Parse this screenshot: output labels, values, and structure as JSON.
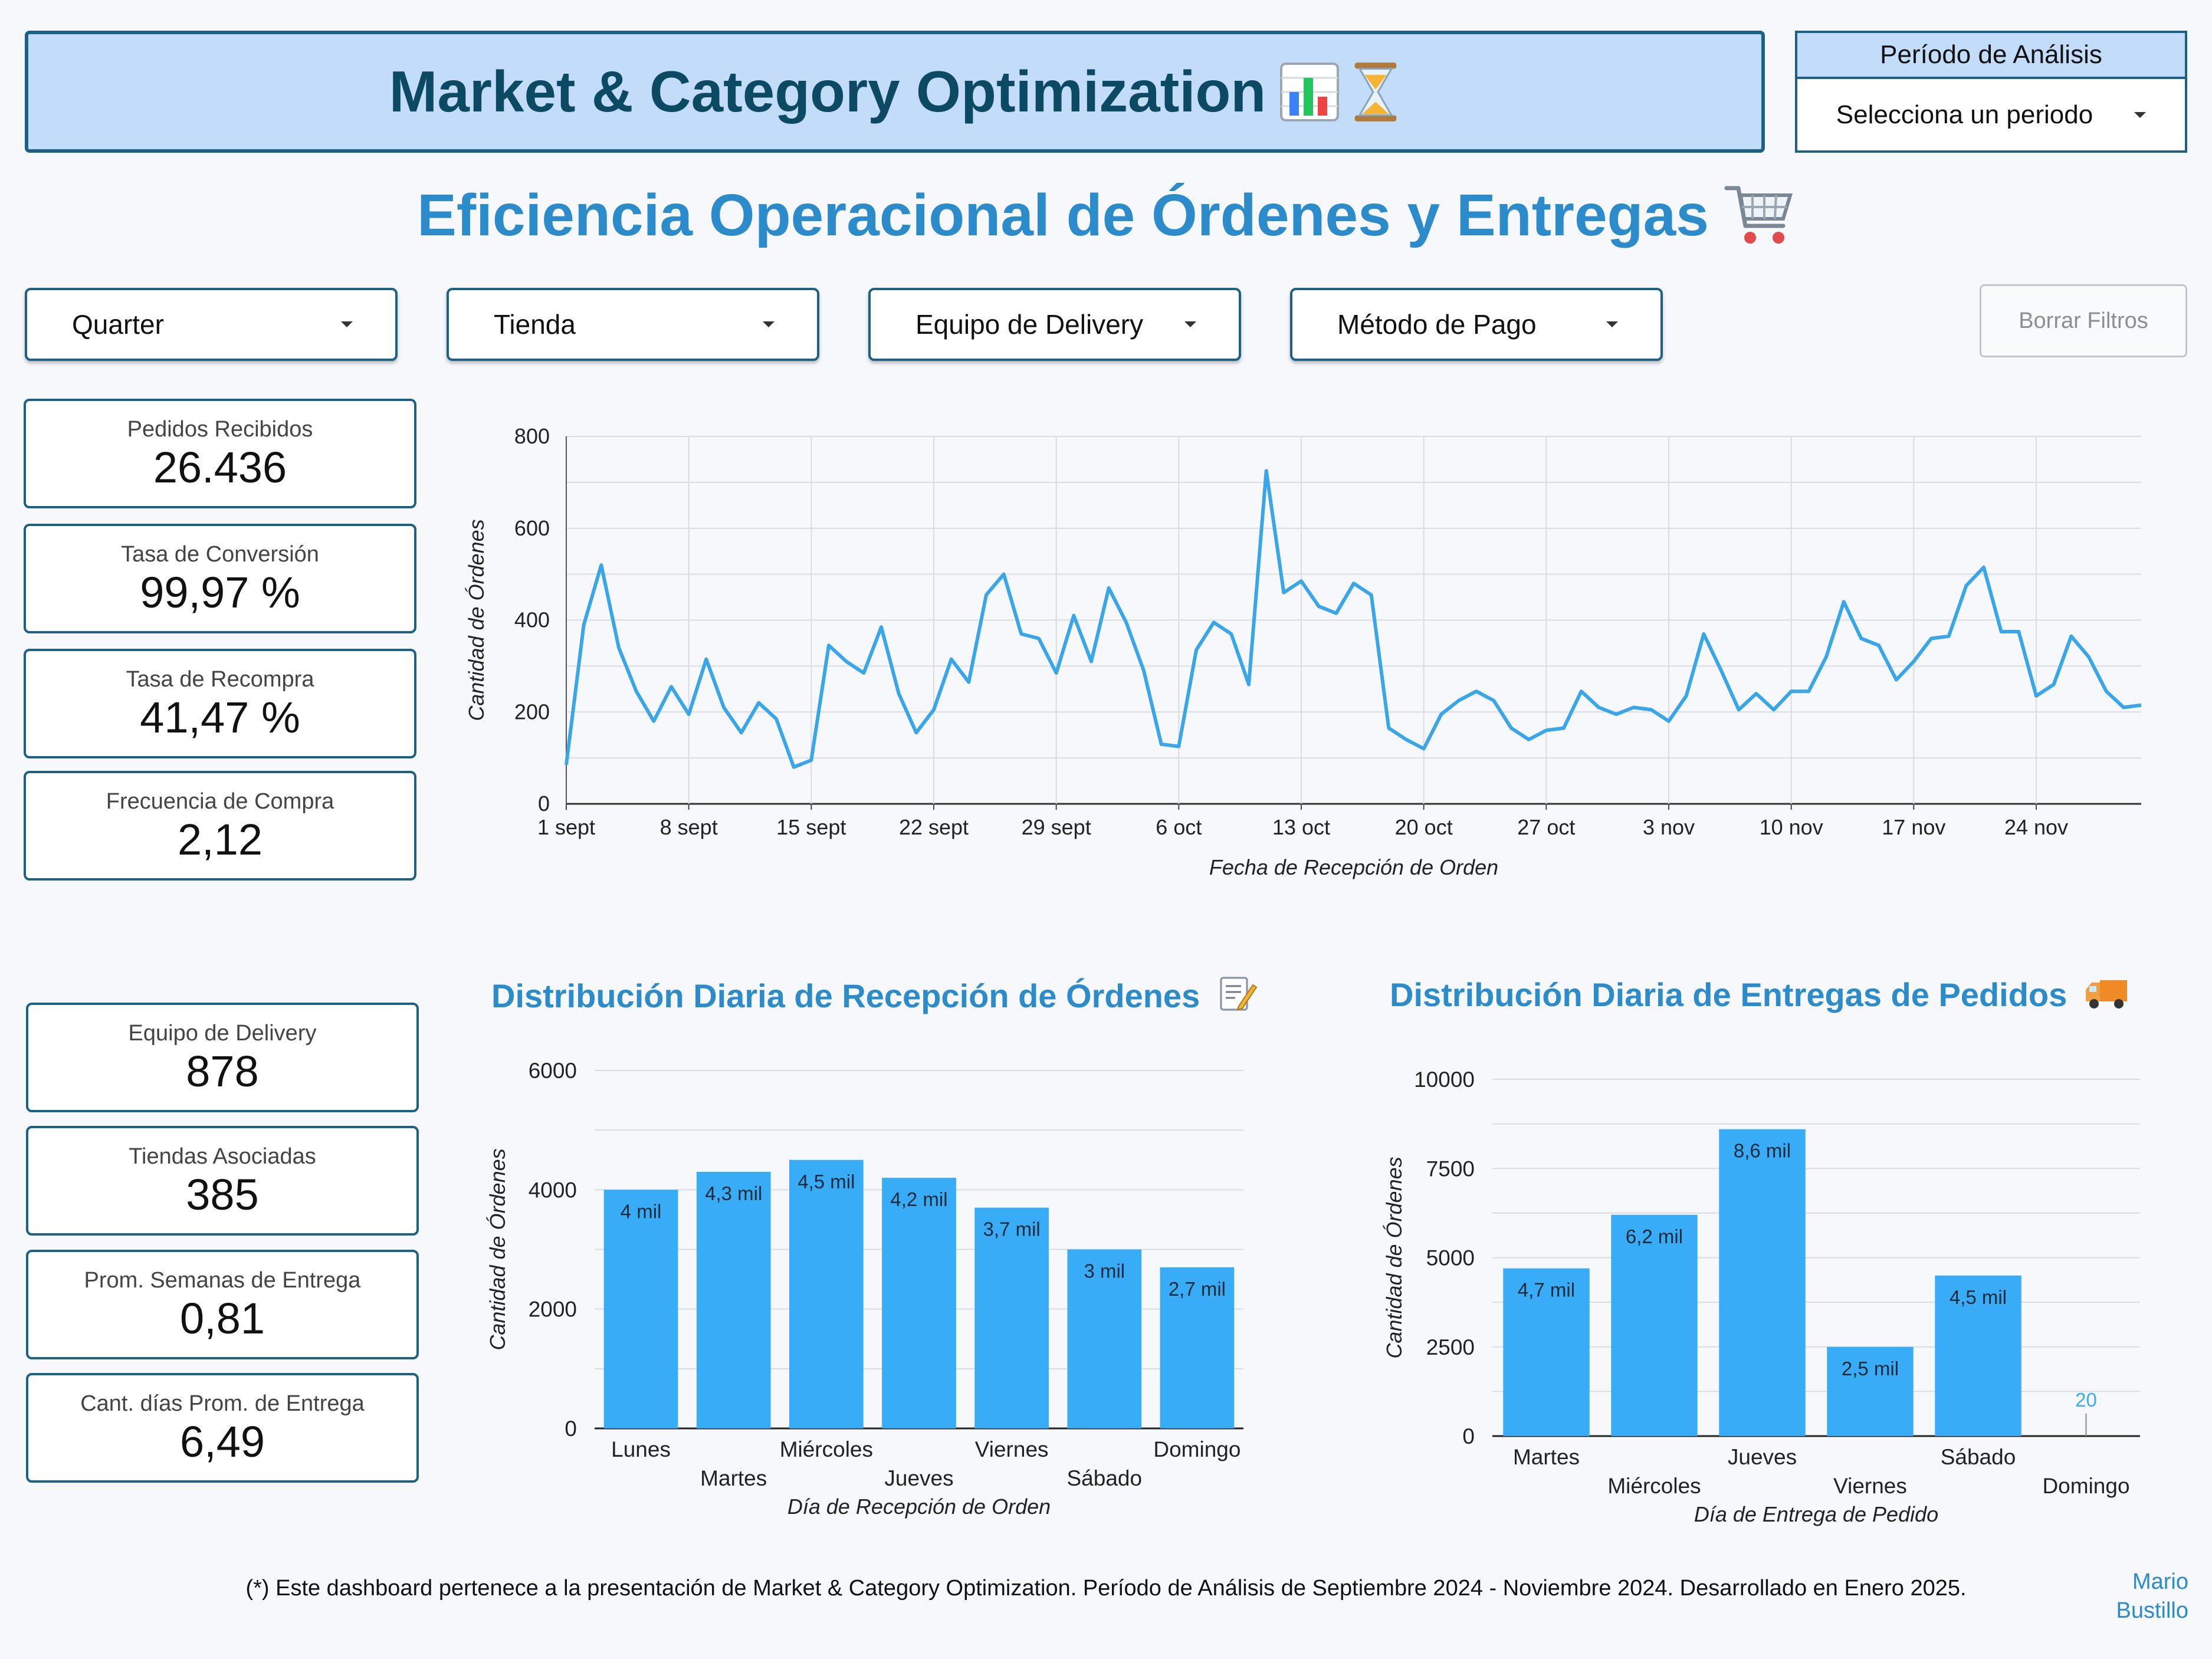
{
  "header": {
    "title": "Market & Category Optimization",
    "period_label": "Período de Análisis",
    "period_placeholder": "Selecciona un periodo"
  },
  "subtitle": "Eficiencia Operacional de Órdenes y Entregas",
  "filters": {
    "quarter": "Quarter",
    "tienda": "Tienda",
    "equipo": "Equipo de Delivery",
    "metodo": "Método de Pago",
    "clear": "Borrar Filtros"
  },
  "kpis_top": [
    {
      "label": "Pedidos Recibidos",
      "value": "26.436"
    },
    {
      "label": "Tasa de Conversión",
      "value": "99,97 %"
    },
    {
      "label": "Tasa de Recompra",
      "value": "41,47 %"
    },
    {
      "label": "Frecuencia de Compra",
      "value": "2,12"
    }
  ],
  "kpis_bottom": [
    {
      "label": "Equipo de Delivery",
      "value": "878"
    },
    {
      "label": "Tiendas Asociadas",
      "value": "385"
    },
    {
      "label": "Prom. Semanas de Entrega",
      "value": "0,81"
    },
    {
      "label": "Cant. días Prom. de Entrega",
      "value": "6,49"
    }
  ],
  "chart_data": [
    {
      "type": "line",
      "xlabel": "Fecha de Recepción de Orden",
      "ylabel": "Cantidad de Órdenes",
      "ylim": [
        0,
        800
      ],
      "yticks": [
        0,
        200,
        400,
        600,
        800
      ],
      "xtick_labels": [
        "1 sept",
        "8 sept",
        "15 sept",
        "22 sept",
        "29 sept",
        "6 oct",
        "13 oct",
        "20 oct",
        "27 oct",
        "3 nov",
        "10 nov",
        "17 nov",
        "24 nov"
      ],
      "x_start": "1 sept",
      "grid": true,
      "color": "#3aa6ea",
      "values": [
        85,
        390,
        520,
        340,
        245,
        180,
        255,
        195,
        315,
        210,
        155,
        220,
        185,
        80,
        95,
        345,
        310,
        285,
        385,
        240,
        155,
        205,
        315,
        265,
        455,
        500,
        370,
        360,
        285,
        410,
        310,
        470,
        395,
        290,
        130,
        125,
        335,
        395,
        370,
        260,
        725,
        460,
        485,
        430,
        415,
        480,
        455,
        165,
        140,
        120,
        195,
        225,
        245,
        225,
        165,
        140,
        160,
        165,
        245,
        210,
        195,
        210,
        205,
        180,
        235,
        370,
        290,
        205,
        240,
        205,
        245,
        245,
        320,
        440,
        360,
        345,
        270,
        310,
        360,
        365,
        475,
        515,
        375,
        375,
        235,
        260,
        365,
        320,
        245,
        210,
        215
      ]
    },
    {
      "type": "bar",
      "title": "Distribución Diaria de Recepción de Órdenes",
      "xlabel": "Día de Recepción de Orden",
      "ylabel": "Cantidad de Órdenes",
      "ylim": [
        0,
        6000
      ],
      "yticks": [
        0,
        2000,
        4000,
        6000
      ],
      "categories": [
        "Lunes",
        "Martes",
        "Miércoles",
        "Jueves",
        "Viernes",
        "Sábado",
        "Domingo"
      ],
      "values": [
        4000,
        4300,
        4500,
        4200,
        3700,
        3000,
        2700
      ],
      "data_labels": [
        "4 mil",
        "4,3 mil",
        "4,5 mil",
        "4,2 mil",
        "3,7 mil",
        "3 mil",
        "2,7 mil"
      ],
      "color": "#38acf7"
    },
    {
      "type": "bar",
      "title": "Distribución Diaria de Entregas de Pedidos",
      "xlabel": "Día de Entrega de Pedido",
      "ylabel": "Cantidad de Órdenes",
      "ylim": [
        0,
        10000
      ],
      "yticks": [
        0,
        2500,
        5000,
        7500,
        10000
      ],
      "categories": [
        "Martes",
        "Miércoles",
        "Jueves",
        "Viernes",
        "Sábado",
        "Domingo"
      ],
      "values": [
        4700,
        6200,
        8600,
        2500,
        4500,
        20
      ],
      "data_labels": [
        "4,7 mil",
        "6,2 mil",
        "8,6 mil",
        "2,5 mil",
        "4,5 mil",
        "20"
      ],
      "color": "#38acf7"
    }
  ],
  "footer": {
    "note": "(*) Este dashboard pertenece a la presentación de Market & Category Optimization. Período de Análisis de Septiembre 2024 - Noviembre 2024. Desarrollado en Enero 2025.",
    "author_line1": "Mario",
    "author_line2": "Bustillo"
  }
}
